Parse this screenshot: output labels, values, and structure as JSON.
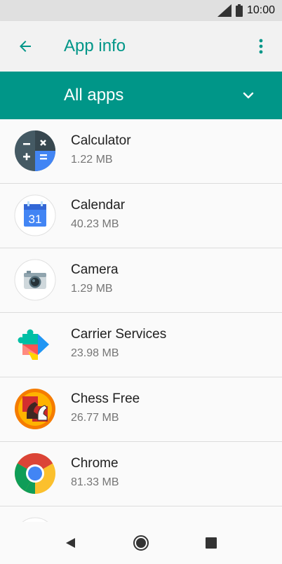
{
  "status_bar": {
    "time": "10:00",
    "icons": [
      "signal-icon",
      "battery-icon"
    ]
  },
  "appbar": {
    "title": "App info",
    "back_icon": "arrow-left-icon",
    "menu_icon": "more-vert-icon"
  },
  "filter": {
    "label": "All apps",
    "icon": "chevron-down-icon"
  },
  "apps": [
    {
      "name": "Calculator",
      "size": "1.22 MB",
      "icon": "calculator-icon"
    },
    {
      "name": "Calendar",
      "size": "40.23 MB",
      "icon": "calendar-icon",
      "icon_text": "31"
    },
    {
      "name": "Camera",
      "size": "1.29 MB",
      "icon": "camera-icon"
    },
    {
      "name": "Carrier Services",
      "size": "23.98 MB",
      "icon": "carrier-services-icon"
    },
    {
      "name": "Chess Free",
      "size": "26.77 MB",
      "icon": "chess-icon"
    },
    {
      "name": "Chrome",
      "size": "81.33 MB",
      "icon": "chrome-icon"
    }
  ],
  "navbar": {
    "icons": [
      "back-triangle-icon",
      "home-circle-icon",
      "recents-square-icon"
    ]
  },
  "colors": {
    "accent": "#009688",
    "background": "#fafafa",
    "status_bar": "#e0e0e0"
  }
}
